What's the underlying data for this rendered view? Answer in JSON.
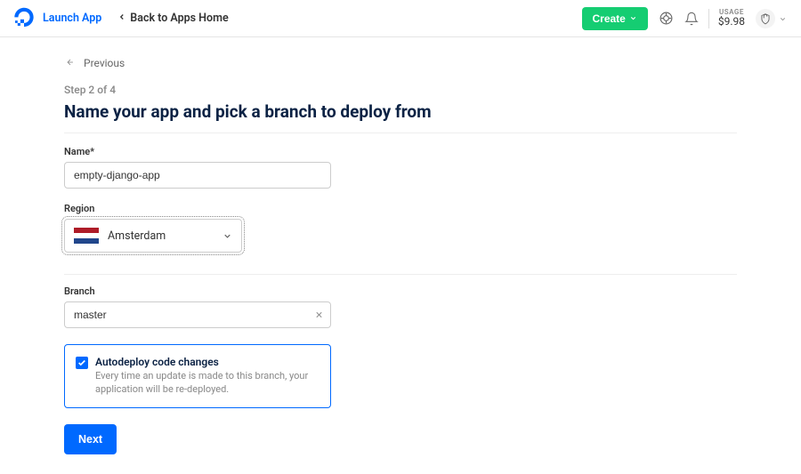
{
  "header": {
    "brand": "Launch App",
    "back_label": "Back to Apps Home",
    "create_label": "Create",
    "usage_label": "USAGE",
    "usage_amount": "$9.98"
  },
  "nav": {
    "previous_label": "Previous"
  },
  "wizard": {
    "step_label": "Step 2 of 4",
    "title": "Name your app and pick a branch to deploy from"
  },
  "fields": {
    "name_label": "Name",
    "name_required_mark": "*",
    "name_value": "empty-django-app",
    "region_label": "Region",
    "region_value": "Amsterdam",
    "branch_label": "Branch",
    "branch_value": "master"
  },
  "autodeploy": {
    "checked": true,
    "title": "Autodeploy code changes",
    "description": "Every time an update is made to this branch, your application will be re-deployed."
  },
  "actions": {
    "next_label": "Next"
  }
}
